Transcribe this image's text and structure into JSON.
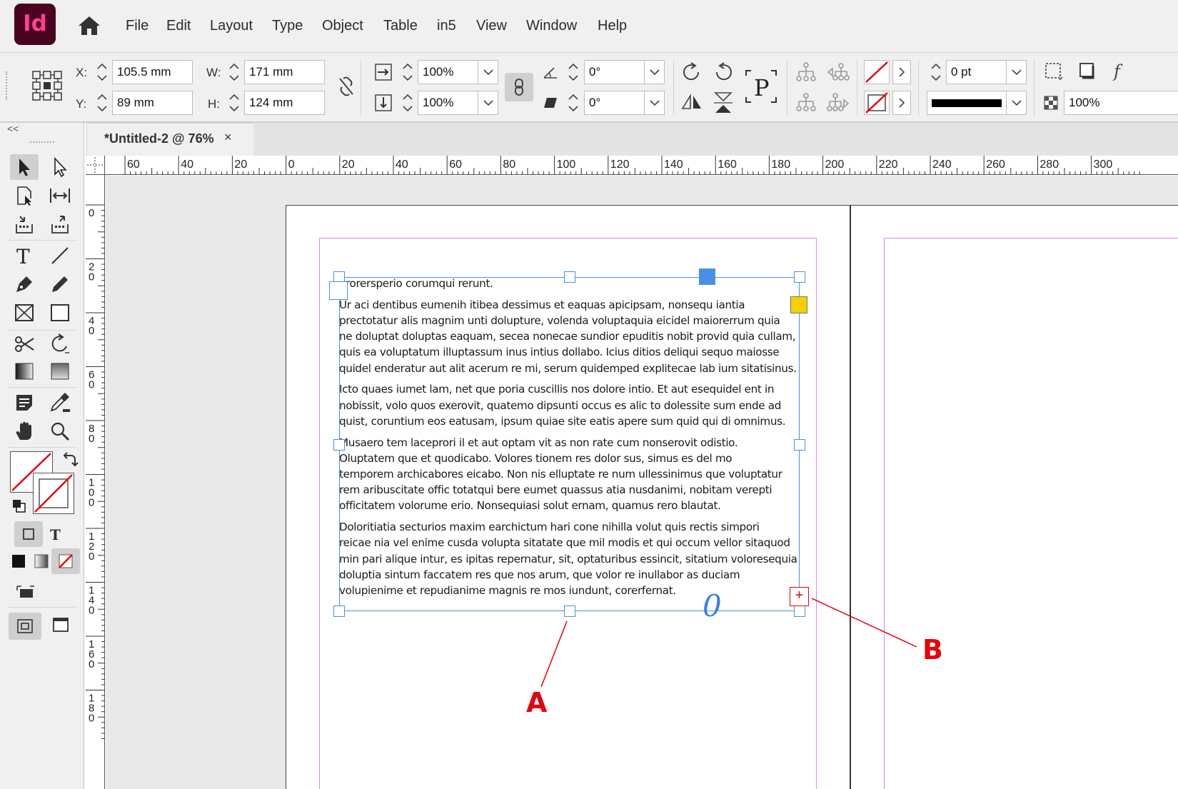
{
  "app": {
    "logo_text": "Id",
    "home_icon": "home-icon"
  },
  "menu": [
    "File",
    "Edit",
    "Layout",
    "Type",
    "Object",
    "Table",
    "in5",
    "View",
    "Window",
    "Help"
  ],
  "control": {
    "x_label": "X:",
    "x_value": "105.5 mm",
    "y_label": "Y:",
    "y_value": "89 mm",
    "w_label": "W:",
    "w_value": "171 mm",
    "h_label": "H:",
    "h_value": "124 mm",
    "scale_x": "100%",
    "scale_y": "100%",
    "rotate": "0°",
    "shear": "0°",
    "stroke_weight": "0 pt",
    "opacity": "100%"
  },
  "tools": {
    "collapse": "<<"
  },
  "document": {
    "tab_title": "*Untitled-2 @ 76%",
    "tab_close": "×"
  },
  "rulers": {
    "horizontal": [
      "60",
      "40",
      "20",
      "0",
      "20",
      "40",
      "60",
      "80",
      "100",
      "120",
      "140",
      "160",
      "180",
      "200",
      "220",
      "240",
      "260",
      "280",
      "300"
    ],
    "vertical": [
      "0",
      "20",
      "40",
      "60",
      "80",
      "100",
      "120",
      "140",
      "160",
      "180"
    ]
  },
  "story": {
    "paragraphs": [
      "erorersperio corumqui rerunt.",
      "Ur aci dentibus eumenih itibea dessimus et eaquas apicipsam, nonsequ iantia\nprectotatur alis magnim unti dolupture, volenda voluptaquia eicidel maiorerrum quia\nne doluptat doluptas eaquam, secea nonecae sundior epuditis nobit provid quia cullam,\nquis ea voluptatum illuptassum inus intius dollabo. Icius ditios deliqui sequo maiosse\nquidel enderatur aut alit acerum re mi, serum quidemped explitecae lab ium sitatisinus.",
      "Icto quaes iumet lam, net que poria cuscillis nos dolore intio. Et aut esequidel ent in\nnobissit, volo quos exerovit, quatemo dipsunti occus es alic to dolessite sum ende ad\nquist, coruntium eos eatusam, ipsum quiae site eatis apere sum quid qui di omnimus.",
      "Musaero tem laceprori il et aut optam vit as non rate cum nonserovit odistio.\nOluptatem que et quodicabo. Volores tionem res dolor sus, simus es del mo\ntemporem archicabores eicabo. Non nis elluptate re num ullessinimus que voluptatur\nrem aribuscitate offic totatqui bere eumet quassus atia nusdanimi, nobitam verepti\nofficitatem volorume erio. Nonsequiasi solut ernam, quamus rero blautat.",
      "Doloritiatia secturios maxim earchictum hari cone nihilla volut quis rectis simpori\nreicae nia vel enime cusda volupta sitatate que mil modis et qui occum vellor sitaquod\nmin pari alique intur, es ipitas repernatur, sit, optaturibus essincit, sitatium voloresequia\ndoluptia sintum faccatem res que nos arum, que volor re inullabor as duciam\nvolupienime et repudianime magnis re mos iundunt, corerfernat."
    ]
  },
  "frame": {
    "out_port_symbol": "+",
    "content_glyph": "0"
  },
  "callouts": {
    "a": "A",
    "b": "B"
  },
  "colors": {
    "accent": "#4a90e2",
    "margin": "#d48bf2",
    "callout": "#e8000d",
    "anchor": "#f5d000",
    "logo_bg": "#49021f"
  }
}
